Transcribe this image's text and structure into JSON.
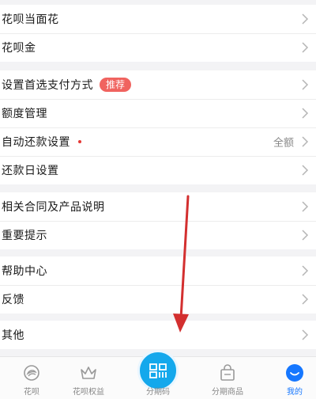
{
  "menu": {
    "group1": [
      {
        "label": "花呗当面花"
      },
      {
        "label": "花呗金"
      }
    ],
    "group2": [
      {
        "label": "设置首选支付方式",
        "badge": "推荐"
      },
      {
        "label": "额度管理"
      },
      {
        "label": "自动还款设置",
        "value": "全额"
      },
      {
        "label": "还款日设置"
      }
    ],
    "group3": [
      {
        "label": "相关合同及产品说明"
      },
      {
        "label": "重要提示"
      }
    ],
    "group4": [
      {
        "label": "帮助中心"
      },
      {
        "label": "反馈"
      }
    ],
    "group5": [
      {
        "label": "其他"
      }
    ]
  },
  "tabbar": {
    "items": [
      {
        "label": "花呗",
        "icon": "huabei-icon"
      },
      {
        "label": "花呗权益",
        "icon": "crown-icon"
      },
      {
        "label": "分期码",
        "icon": "installment-code-icon"
      },
      {
        "label": "分期商品",
        "icon": "shopping-bag-icon"
      },
      {
        "label": "我的",
        "icon": "profile-icon"
      }
    ],
    "active_index": 4
  },
  "colors": {
    "accent": "#1677ff",
    "center_button": "#14a8ec",
    "badge": "#f0635f",
    "annotation_arrow": "#d32f2f"
  }
}
